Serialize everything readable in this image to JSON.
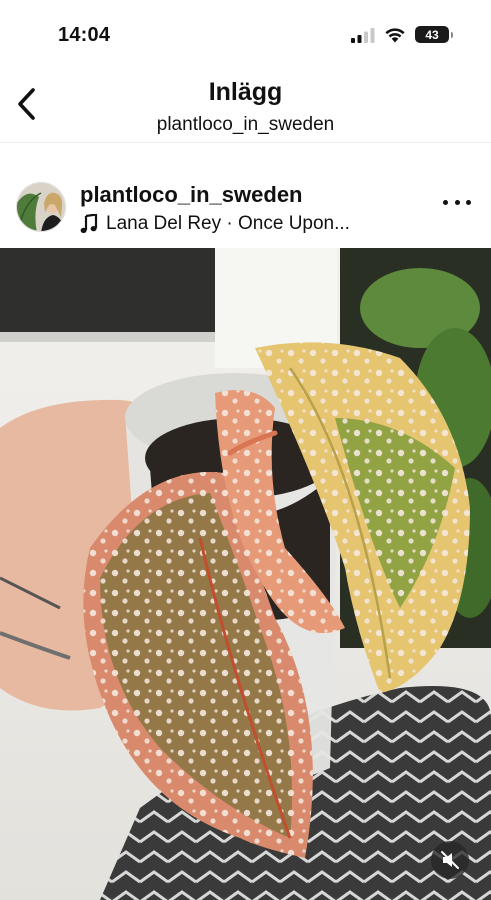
{
  "status_bar": {
    "time": "14:04",
    "battery": "43"
  },
  "header": {
    "title": "Inlägg",
    "subtitle": "plantloco_in_sweden"
  },
  "post": {
    "username": "plantloco_in_sweden",
    "music": "Lana Del Rey · Once Upon..."
  },
  "icons": {
    "back": "chevron-left-icon",
    "music": "music-note-icon",
    "more": "more-horizontal-icon",
    "mute": "speaker-muted-icon"
  },
  "colors": {
    "text": "#111111",
    "divider": "#ededed"
  }
}
